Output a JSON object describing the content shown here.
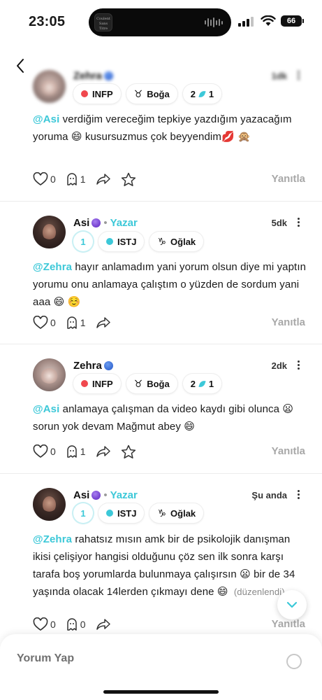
{
  "status_bar": {
    "time": "23:05",
    "battery": "66",
    "now_playing_art": "Coulent Sans Titre"
  },
  "comments": [
    {
      "name": "Zehra",
      "date": "1dk",
      "is_author": false,
      "chips": [
        "INFP",
        "Boğa",
        "2",
        "1"
      ],
      "mention": "@Asi",
      "text": "verdiğim vereceğim tepkiye yazdığım yazacağım yoruma 😄  kusursuzmus çok beyyendim💋 🙊",
      "likes": "0",
      "ghosts": "1",
      "reply_label": "Yanıtla",
      "blurred_header": true
    },
    {
      "name": "Asi",
      "author_label": "Yazar",
      "date": "5dk",
      "is_author": true,
      "chips": [
        "1",
        "ISTJ",
        "Oğlak"
      ],
      "mention": "@Zehra",
      "text": "hayır anlamadım yani yorum olsun diye mi yaptın yorumu onu anlamaya çalıştım o yüzden de sordum yani aaa 😄 ☺️",
      "likes": "0",
      "ghosts": "1",
      "reply_label": "Yanıtla"
    },
    {
      "name": "Zehra",
      "date": "2dk",
      "is_author": false,
      "chips": [
        "INFP",
        "Boğa",
        "2",
        "1"
      ],
      "mention": "@Asi",
      "text": "anlamaya çalışman da video kaydı gibi olunca 😦  sorun yok devam Mağmut abey 😄",
      "likes": "0",
      "ghosts": "1",
      "reply_label": "Yanıtla"
    },
    {
      "name": "Asi",
      "author_label": "Yazar",
      "date": "Şu anda",
      "is_author": true,
      "chips": [
        "1",
        "ISTJ",
        "Oğlak"
      ],
      "mention": "@Zehra",
      "text": "rahatsız mısın amk bir de psikolojik danışman ikisi çelişiyor hangisi olduğunu çöz sen ilk sonra karşı tarafa boş yorumlarda bulunmaya çalışırsın 😦  bir de 34 yaşında olacak 14lerden çıkmayı dene 😄",
      "edited": "(düzenlendi)",
      "likes": "0",
      "ghosts": "0",
      "reply_label": "Yanıtla"
    }
  ],
  "composer": {
    "placeholder": "Yorum Yap"
  },
  "icons": {
    "back": "chevron-left-icon",
    "verified": "badge-dot-icon",
    "like": "heart-icon",
    "ghost": "ghost-icon",
    "share": "share-arrow-icon",
    "star": "star-icon",
    "more": "kebab-icon",
    "scroll": "chevron-down-icon"
  },
  "colors": {
    "accent": "#3cc8d8",
    "mbti_red": "#f0484e",
    "reply_gray": "#a8a8a8"
  }
}
